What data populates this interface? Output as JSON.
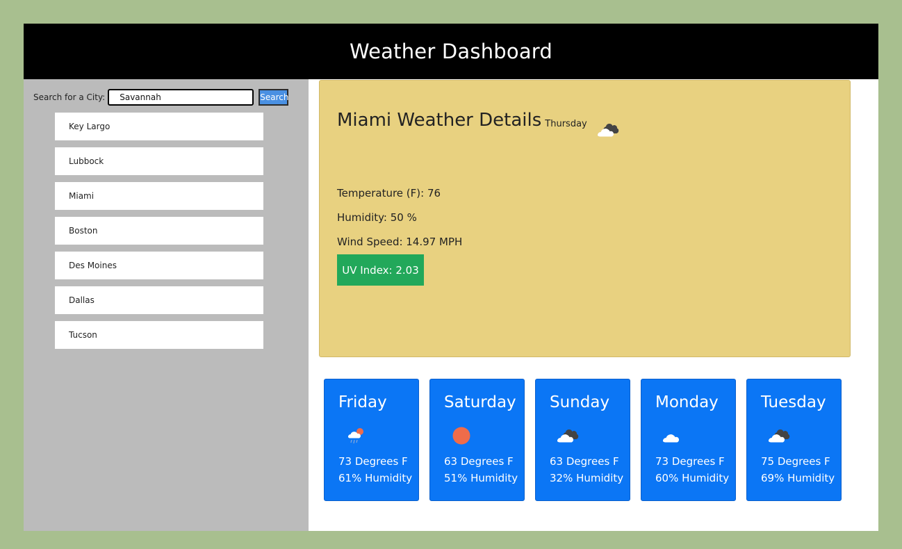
{
  "header": {
    "title": "Weather Dashboard"
  },
  "search": {
    "label": "Search for a City:",
    "value": "Savannah",
    "button_label": "Search"
  },
  "cities": [
    "Key Largo",
    "Lubbock",
    "Miami",
    "Boston",
    "Des Moines",
    "Dallas",
    "Tucson"
  ],
  "current": {
    "title": "Miami Weather Details",
    "day": "Thursday",
    "icon": "broken-clouds-icon",
    "temperature": "Temperature (F): 76",
    "humidity": "Humidity: 50 %",
    "wind": "Wind Speed: 14.97 MPH",
    "uv": "UV Index: 2.03",
    "uv_color": "#22a85a"
  },
  "forecast": [
    {
      "day": "Friday",
      "icon": "rain-icon",
      "temp": "73 Degrees F",
      "humidity": "61% Humidity"
    },
    {
      "day": "Saturday",
      "icon": "sun-icon",
      "temp": "63 Degrees F",
      "humidity": "51% Humidity"
    },
    {
      "day": "Sunday",
      "icon": "broken-clouds-icon",
      "temp": "63 Degrees F",
      "humidity": "32% Humidity"
    },
    {
      "day": "Monday",
      "icon": "cloud-icon",
      "temp": "73 Degrees F",
      "humidity": "60% Humidity"
    },
    {
      "day": "Tuesday",
      "icon": "broken-clouds-icon",
      "temp": "75 Degrees F",
      "humidity": "69% Humidity"
    }
  ],
  "colors": {
    "background": "#a8bf8f",
    "header": "#000000",
    "sidebar": "#bbbbbb",
    "current_panel": "#e8d180",
    "forecast_card": "#0b76f5",
    "search_button": "#4a90e2"
  }
}
